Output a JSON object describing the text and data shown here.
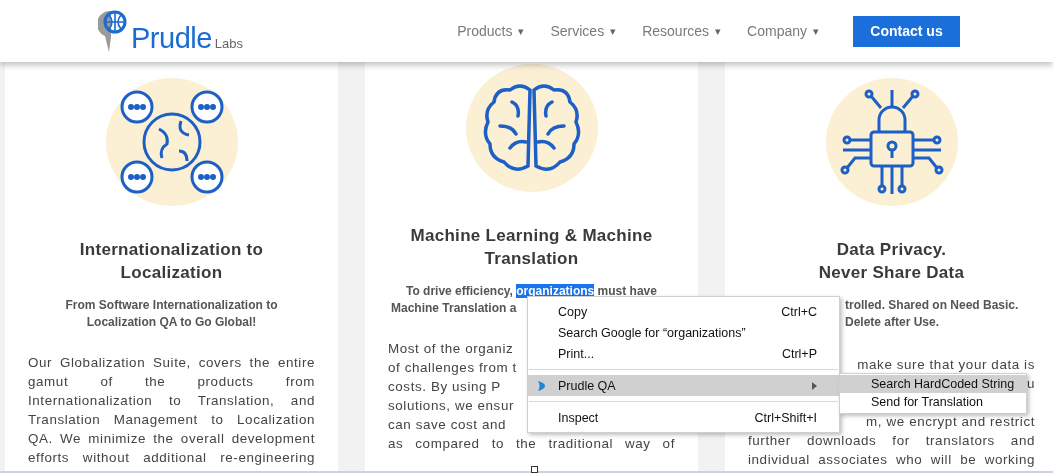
{
  "header": {
    "logo": {
      "name": "Prudle",
      "suffix": "Labs"
    },
    "nav": [
      {
        "label": "Products",
        "caret": "▾"
      },
      {
        "label": "Services",
        "caret": "▾"
      },
      {
        "label": "Resources",
        "caret": "▾"
      },
      {
        "label": "Company",
        "caret": "▾"
      }
    ],
    "contact_button": "Contact us"
  },
  "cards": [
    {
      "kind": "globe",
      "title": [
        "Internationalization to",
        "Localization"
      ],
      "subtitle": [
        [
          {
            "text": "From Software Internationalization to",
            "selected": false
          }
        ],
        [
          {
            "text": "Localization QA to Go Global!",
            "selected": false
          }
        ]
      ],
      "body": [
        {
          "text": "Our Globalization Suite, covers the entire",
          "kind": "full"
        },
        {
          "text": "gamut of the products from",
          "kind": "full"
        },
        {
          "text": "Internationalization to Translation, and",
          "kind": "full"
        },
        {
          "text": "Translation Management to Localization",
          "kind": "full"
        },
        {
          "text": "QA. We minimize the overall development",
          "kind": "full"
        },
        {
          "text": "efforts without additional re-engineering",
          "kind": "full"
        }
      ]
    },
    {
      "kind": "brain",
      "title": [
        "Machine Learning & Machine",
        "Translation"
      ],
      "subtitle": [
        [
          {
            "text": "To drive efficiency, ",
            "selected": false
          },
          {
            "text": "organizations",
            "selected": true
          },
          {
            "text": " must have",
            "selected": false
          }
        ],
        [
          {
            "text": "Machine Translation a",
            "selected": false
          }
        ]
      ],
      "body": [
        {
          "text": "Most of the organiz",
          "kind": "start"
        },
        {
          "text": "of challenges from t",
          "kind": "start"
        },
        {
          "text": "costs. By using P",
          "kind": "start"
        },
        {
          "text": "solutions, we ensur",
          "kind": "start"
        },
        {
          "text": "can save cost and",
          "kind": "start"
        },
        {
          "text": "as compared to the traditional way of",
          "kind": "full"
        }
      ]
    },
    {
      "kind": "lock",
      "title": [
        "Data Privacy.",
        "Never Share Data"
      ],
      "subtitle": [
        [
          {
            "text": "trolled. Shared on Need Basic.",
            "selected": false
          }
        ],
        [
          {
            "text": "Delete after Use.",
            "selected": false
          }
        ]
      ],
      "body": [
        {
          "text": "make sure that your data is",
          "kind": "end"
        },
        {
          "text": "u",
          "kind": "end"
        },
        {
          "kind": "blank"
        },
        {
          "text": "m, we encrypt and restrict",
          "kind": "end"
        },
        {
          "text": "further downloads for translators and",
          "kind": "full"
        },
        {
          "text": "individual associates who will be working",
          "kind": "full"
        }
      ]
    }
  ],
  "context_menu": {
    "items": [
      {
        "kind": "item",
        "label": "Copy",
        "shortcut": "Ctrl+C",
        "highlighted": false
      },
      {
        "kind": "item",
        "label": "Search Google for “organizations”",
        "highlighted": false
      },
      {
        "kind": "item",
        "label": "Print...",
        "shortcut": "Ctrl+P",
        "highlighted": false
      },
      {
        "kind": "separator"
      },
      {
        "kind": "submenu",
        "label": "Prudle QA",
        "highlighted": true,
        "children": [
          {
            "label": "Search HardCoded String",
            "highlighted": true
          },
          {
            "label": "Send for Translation",
            "highlighted": false
          }
        ]
      },
      {
        "kind": "separator"
      },
      {
        "kind": "item",
        "label": "Inspect",
        "shortcut": "Ctrl+Shift+I",
        "highlighted": false
      }
    ]
  }
}
